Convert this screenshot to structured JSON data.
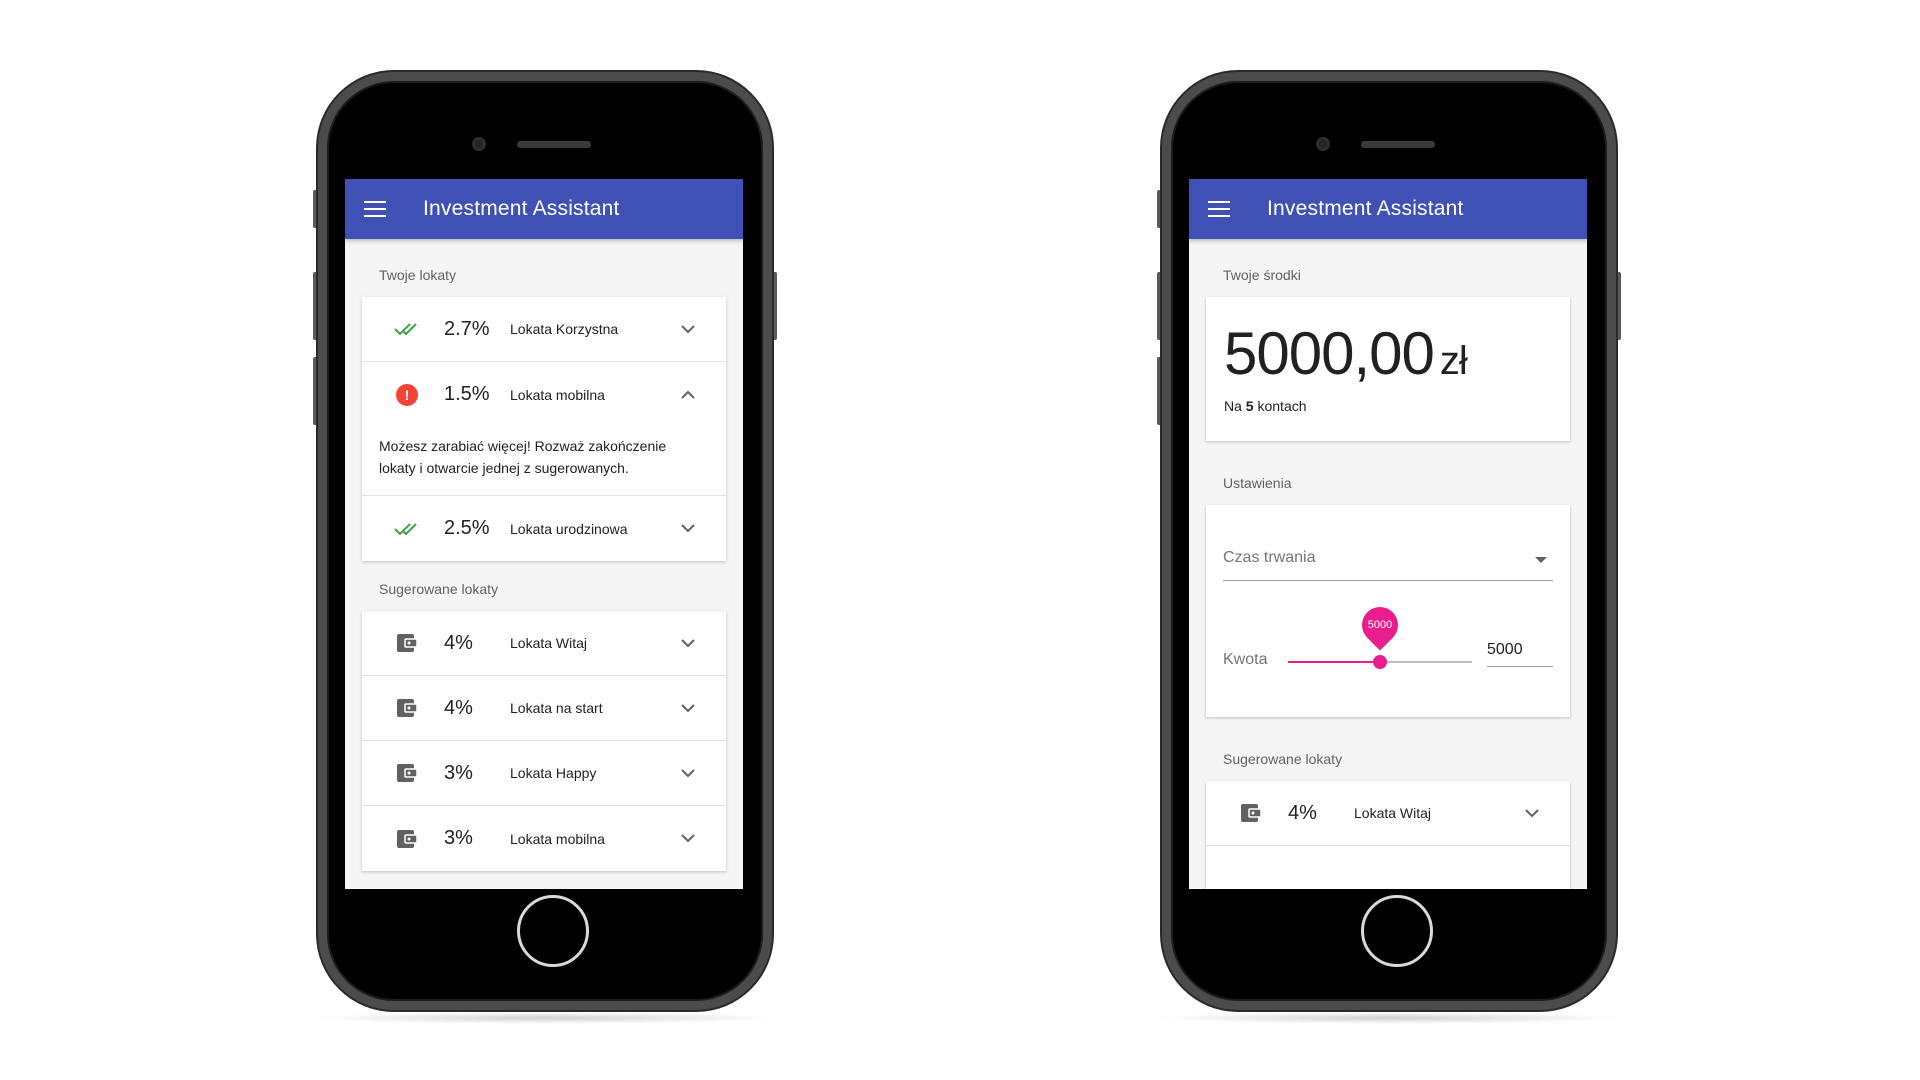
{
  "app": {
    "title": "Investment Assistant"
  },
  "colors": {
    "appbar": "#3f51b5",
    "accent": "#e91e8c",
    "success": "#43a047",
    "error": "#f44336"
  },
  "left": {
    "your_deposits_label": "Twoje lokaty",
    "deposits": [
      {
        "icon": "double-check-icon",
        "rate": "2.7%",
        "name": "Lokata Korzystna",
        "expanded": false
      },
      {
        "icon": "error-icon",
        "icon_glyph": "!",
        "rate": "1.5%",
        "name": "Lokata mobilna",
        "expanded": true,
        "details": "Możesz zarabiać więcej! Rozważ zakończenie lokaty i otwarcie jednej z sugerowanych."
      },
      {
        "icon": "double-check-icon",
        "rate": "2.5%",
        "name": "Lokata urodzinowa",
        "expanded": false
      }
    ],
    "suggested_label": "Sugerowane lokaty",
    "suggested": [
      {
        "icon": "wallet-icon",
        "rate": "4%",
        "name": "Lokata Witaj"
      },
      {
        "icon": "wallet-icon",
        "rate": "4%",
        "name": "Lokata na start"
      },
      {
        "icon": "wallet-icon",
        "rate": "3%",
        "name": "Lokata Happy"
      },
      {
        "icon": "wallet-icon",
        "rate": "3%",
        "name": "Lokata mobilna"
      }
    ]
  },
  "right": {
    "funds_label": "Twoje środki",
    "balance": "5000,00",
    "currency": "zł",
    "accounts_prefix": "Na",
    "accounts_count": "5",
    "accounts_suffix": "kontach",
    "settings_label": "Ustawienia",
    "duration_placeholder": "Czas trwania",
    "amount_label": "Kwota",
    "slider_value": "5000",
    "slider_fraction": 0.5,
    "amount_input": "5000",
    "suggested_label": "Sugerowane lokaty",
    "suggested": [
      {
        "icon": "wallet-icon",
        "rate": "4%",
        "name": "Lokata Witaj"
      }
    ]
  }
}
